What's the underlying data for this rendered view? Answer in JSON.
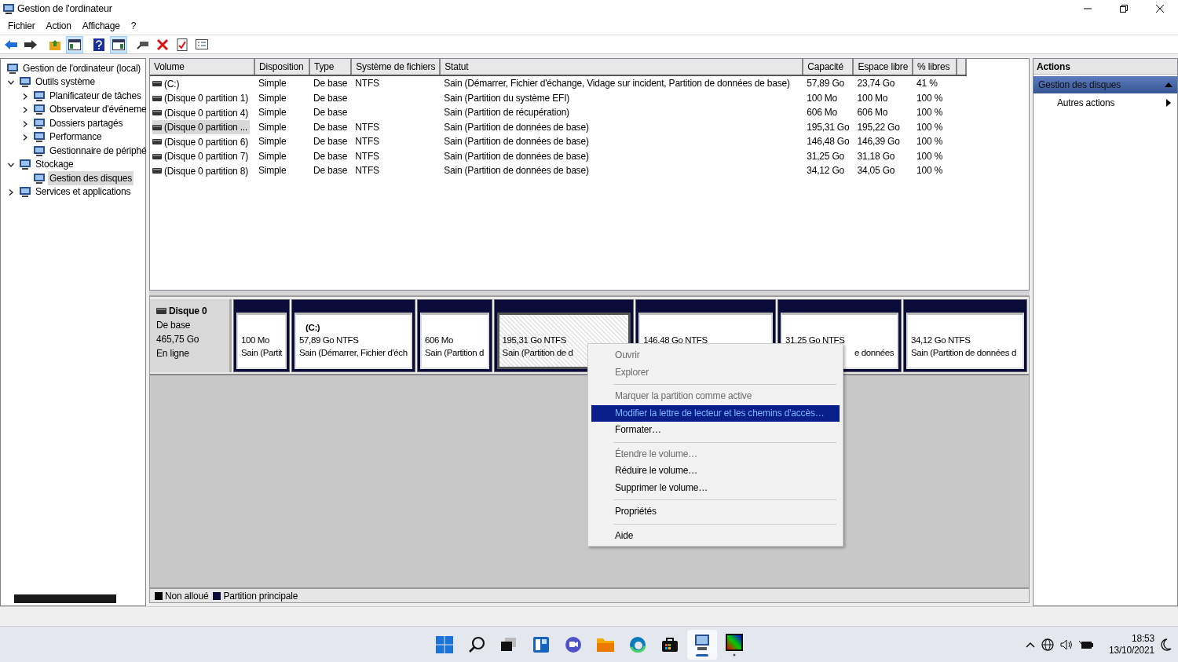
{
  "window": {
    "title": "Gestion de l'ordinateur"
  },
  "menu_bar": [
    "Fichier",
    "Action",
    "Affichage",
    "?"
  ],
  "tree": [
    {
      "label": "Gestion de l'ordinateur (local)",
      "selected": false,
      "children": [
        {
          "label": "Outils système",
          "expanded": true,
          "selected": false,
          "children": [
            {
              "label": "Planificateur de tâches",
              "expanded": false,
              "selected": false
            },
            {
              "label": "Observateur d'événeme",
              "expanded": false,
              "selected": false
            },
            {
              "label": "Dossiers partagés",
              "expanded": false,
              "selected": false
            },
            {
              "label": "Performance",
              "expanded": false,
              "selected": false
            },
            {
              "label": "Gestionnaire de périphé",
              "selected": false
            }
          ]
        },
        {
          "label": "Stockage",
          "expanded": true,
          "selected": false,
          "children": [
            {
              "label": "Gestion des disques",
              "selected": true
            }
          ]
        },
        {
          "label": "Services et applications",
          "expanded": false,
          "selected": false
        }
      ]
    }
  ],
  "volume_table": {
    "columns": [
      "Volume",
      "Disposition",
      "Type",
      "Système de fichiers",
      "Statut",
      "Capacité",
      "Espace libre",
      "% libres"
    ],
    "rows": [
      {
        "selected": false,
        "cells": [
          "(C:)",
          "Simple",
          "De base",
          "NTFS",
          "Sain (Démarrer, Fichier d'échange, Vidage sur incident, Partition de données de base)",
          "57,89 Go",
          "23,74 Go",
          "41 %"
        ]
      },
      {
        "selected": false,
        "cells": [
          "(Disque 0 partition 1)",
          "Simple",
          "De base",
          "",
          "Sain (Partition du système EFI)",
          "100 Mo",
          "100 Mo",
          "100 %"
        ]
      },
      {
        "selected": false,
        "cells": [
          "(Disque 0 partition 4)",
          "Simple",
          "De base",
          "",
          "Sain (Partition de récupération)",
          "606 Mo",
          "606 Mo",
          "100 %"
        ]
      },
      {
        "selected": true,
        "cells": [
          "(Disque 0 partition ...",
          "Simple",
          "De base",
          "NTFS",
          "Sain (Partition de données de base)",
          "195,31 Go",
          "195,22 Go",
          "100 %"
        ]
      },
      {
        "selected": false,
        "cells": [
          "(Disque 0 partition 6)",
          "Simple",
          "De base",
          "NTFS",
          "Sain (Partition de données de base)",
          "146,48 Go",
          "146,39 Go",
          "100 %"
        ]
      },
      {
        "selected": false,
        "cells": [
          "(Disque 0 partition 7)",
          "Simple",
          "De base",
          "NTFS",
          "Sain (Partition de données de base)",
          "31,25 Go",
          "31,18 Go",
          "100 %"
        ]
      },
      {
        "selected": false,
        "cells": [
          "(Disque 0 partition 8)",
          "Simple",
          "De base",
          "NTFS",
          "Sain (Partition de données de base)",
          "34,12 Go",
          "34,05 Go",
          "100 %"
        ]
      }
    ]
  },
  "disk": {
    "name": "Disque 0",
    "type": "De base",
    "size": "465,75 Go",
    "state": "En ligne",
    "partitions": [
      {
        "selected": false,
        "size": "100 Mo",
        "status": "Sain (Partit"
      },
      {
        "selected": false,
        "name": "(C:)",
        "size": "57,89 Go NTFS",
        "status": "Sain (Démarrer, Fichier d'éch"
      },
      {
        "selected": false,
        "size": "606 Mo",
        "status": "Sain (Partition d"
      },
      {
        "selected": true,
        "size": "195,31 Go NTFS",
        "status": "Sain (Partition de d"
      },
      {
        "selected": false,
        "size": "146,48 Go NTFS"
      },
      {
        "selected": false,
        "size": "31,25 Go NTFS",
        "status": "e données"
      },
      {
        "selected": false,
        "size": "34,12 Go NTFS",
        "status": "Sain (Partition de données d"
      }
    ]
  },
  "legend": [
    {
      "label": "Non alloué",
      "color": "#000000"
    },
    {
      "label": "Partition principale",
      "color": "#0a0a3a"
    }
  ],
  "context_menu": [
    {
      "kind": "item",
      "label": "Ouvrir",
      "disabled": true,
      "selected": false
    },
    {
      "kind": "item",
      "label": "Explorer",
      "disabled": true,
      "selected": false
    },
    {
      "kind": "separator"
    },
    {
      "kind": "item",
      "label": "Marquer la partition comme active",
      "disabled": true,
      "selected": false
    },
    {
      "kind": "item",
      "label": "Modifier la lettre de lecteur et les chemins d'accès…",
      "disabled": true,
      "selected": true
    },
    {
      "kind": "item",
      "label": "Formater…",
      "disabled": false,
      "selected": false
    },
    {
      "kind": "separator"
    },
    {
      "kind": "item",
      "label": "Étendre le volume…",
      "disabled": true,
      "selected": false
    },
    {
      "kind": "item",
      "label": "Réduire le volume…",
      "disabled": false,
      "selected": false
    },
    {
      "kind": "item",
      "label": "Supprimer le volume…",
      "disabled": false,
      "selected": false
    },
    {
      "kind": "separator"
    },
    {
      "kind": "item",
      "label": "Propriétés",
      "disabled": false,
      "selected": false
    },
    {
      "kind": "separator"
    },
    {
      "kind": "item",
      "label": "Aide",
      "disabled": false,
      "selected": false
    }
  ],
  "actions": {
    "title": "Actions",
    "sections": [
      {
        "label": "Gestion des disques",
        "expanded": true,
        "items": [
          "Autres actions"
        ]
      }
    ]
  },
  "taskbar": {
    "time": "18:53",
    "date": "13/10/2021"
  }
}
